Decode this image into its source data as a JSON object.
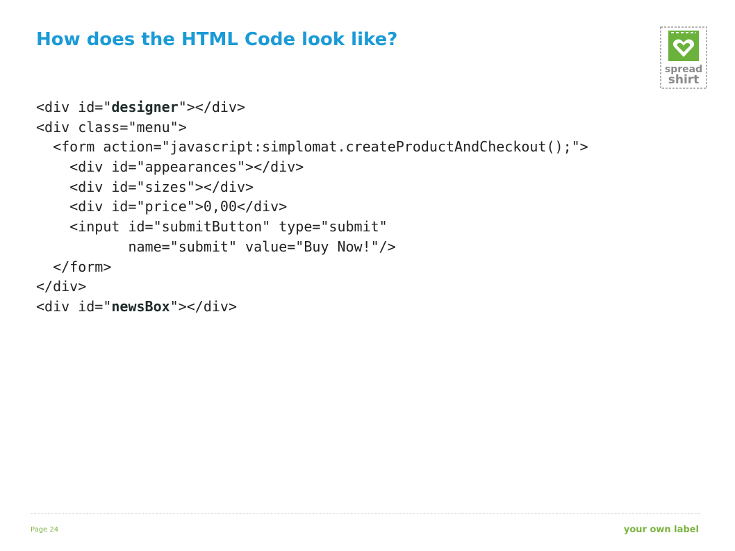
{
  "slide": {
    "title": "How does the HTML Code look like?",
    "logo": {
      "icon": "spreadshirt-logo-icon",
      "text_line1": "spread",
      "text_line2": "shirt",
      "colors": {
        "green": "#6ab23c",
        "gray": "#8a8a8a"
      }
    },
    "code_lines": [
      {
        "parts": [
          {
            "t": "<div id=\""
          },
          {
            "t": "designer",
            "hl": true
          },
          {
            "t": "\"></div>"
          }
        ]
      },
      {
        "parts": [
          {
            "t": "<div class=\"menu\">"
          }
        ]
      },
      {
        "parts": [
          {
            "t": "  <form action=\"javascript:simplomat.createProductAndCheckout();\">"
          }
        ]
      },
      {
        "parts": [
          {
            "t": "    <div id=\"appearances\"></div>"
          }
        ]
      },
      {
        "parts": [
          {
            "t": "    <div id=\"sizes\"></div>"
          }
        ]
      },
      {
        "parts": [
          {
            "t": "    <div id=\"price\">0,00</div>"
          }
        ]
      },
      {
        "parts": [
          {
            "t": "    <input id=\"submitButton\" type=\"submit\""
          }
        ]
      },
      {
        "parts": [
          {
            "t": "           name=\"submit\" value=\"Buy Now!\"/>"
          }
        ]
      },
      {
        "parts": [
          {
            "t": "  </form>"
          }
        ]
      },
      {
        "parts": [
          {
            "t": "</div>"
          }
        ]
      },
      {
        "parts": [
          {
            "t": "<div id=\""
          },
          {
            "t": "newsBox",
            "hl": true
          },
          {
            "t": "\"></div>"
          }
        ]
      }
    ],
    "footer": {
      "page_label": "Page 24",
      "tagline": "your own label"
    },
    "colors": {
      "title": "#1a9ad6",
      "footer": "#7cb342"
    }
  }
}
